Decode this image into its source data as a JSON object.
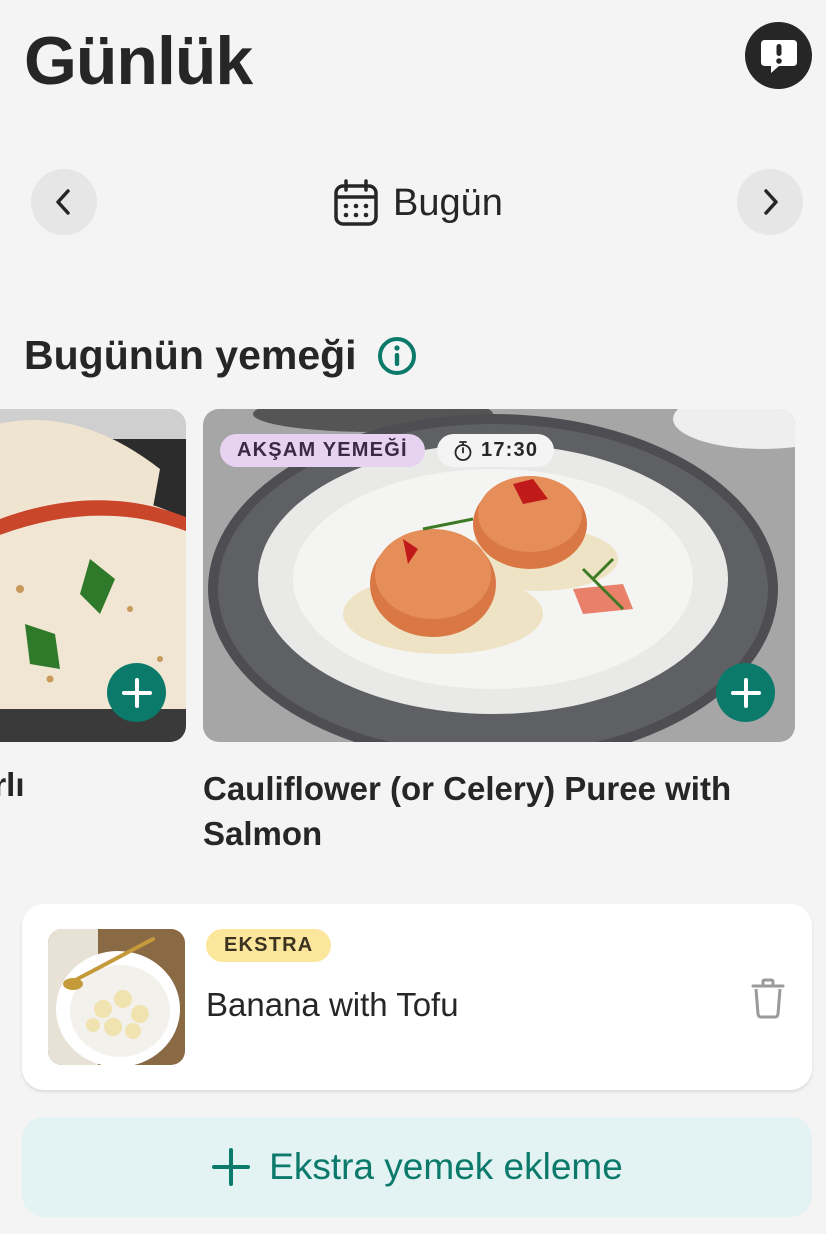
{
  "header": {
    "title": "Günlük",
    "feedback_icon": "exclamation-bubble-icon"
  },
  "date_nav": {
    "prev_icon": "chevron-left-icon",
    "next_icon": "chevron-right-icon",
    "calendar_icon": "calendar-icon",
    "date_label": "Bugün"
  },
  "section": {
    "title": "Bugünün yemeği",
    "info_icon": "info-icon"
  },
  "meals": [
    {
      "title_fragment": "tarlı",
      "image": "quesadilla-photo",
      "add_icon": "plus-icon"
    },
    {
      "tag": "AKŞAM YEMEĞİ",
      "time": "17:30",
      "time_icon": "stopwatch-icon",
      "title": "Cauliflower (or Celery) Puree with Salmon",
      "image": "salmon-cakes-photo",
      "add_icon": "plus-icon"
    }
  ],
  "extra": {
    "badge": "EKSTRA",
    "name": "Banana with Tofu",
    "image": "banana-tofu-photo",
    "delete_icon": "trash-icon"
  },
  "add_extra": {
    "label": "Ekstra yemek ekleme",
    "icon": "plus-icon"
  },
  "colors": {
    "accent": "#0b7a6b",
    "background": "#f4f4f4",
    "meal_tag": "#e7d3f1",
    "extra_badge": "#fbe69c",
    "add_extra_bg": "#e3f2f2"
  }
}
